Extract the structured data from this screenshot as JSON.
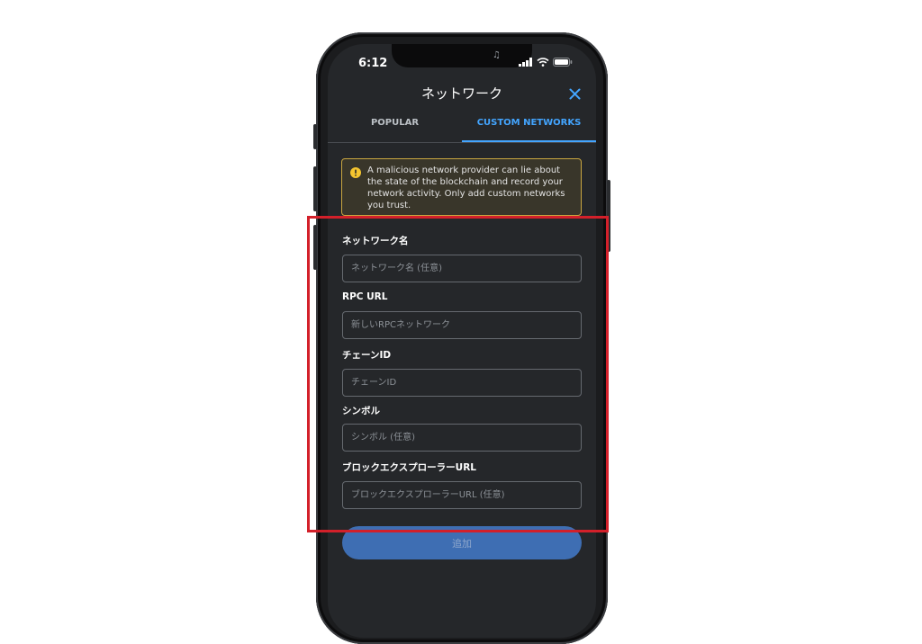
{
  "status_bar": {
    "time": "6:12"
  },
  "header": {
    "title": "ネットワーク"
  },
  "tabs": [
    {
      "label": "POPULAR",
      "active": false
    },
    {
      "label": "CUSTOM NETWORKS",
      "active": true
    }
  ],
  "warning": {
    "text": "A malicious network provider can lie about the state of the blockchain and record your network activity. Only add custom networks you trust.",
    "border_color": "#c9a640"
  },
  "form": {
    "network_name": {
      "label": "ネットワーク名",
      "placeholder": "ネットワーク名 (任意)",
      "value": ""
    },
    "rpc_url": {
      "label": "RPC URL",
      "placeholder": "新しいRPCネットワーク",
      "value": ""
    },
    "chain_id": {
      "label": "チェーンID",
      "placeholder": "チェーンID",
      "value": ""
    },
    "symbol": {
      "label": "シンボル",
      "placeholder": "シンボル (任意)",
      "value": ""
    },
    "explorer_url": {
      "label": "ブロックエクスプローラーURL",
      "placeholder": "ブロックエクスプローラーURL (任意)",
      "value": ""
    }
  },
  "add_button": {
    "label": "追加"
  },
  "colors": {
    "accent": "#43a5ff",
    "background": "#25272a",
    "button": "#3e6eb3",
    "highlight": "#d3202a"
  },
  "icons": {
    "close": "close-icon",
    "warning": "warning-icon",
    "signal": "signal-icon",
    "wifi": "wifi-icon",
    "battery": "battery-icon"
  }
}
